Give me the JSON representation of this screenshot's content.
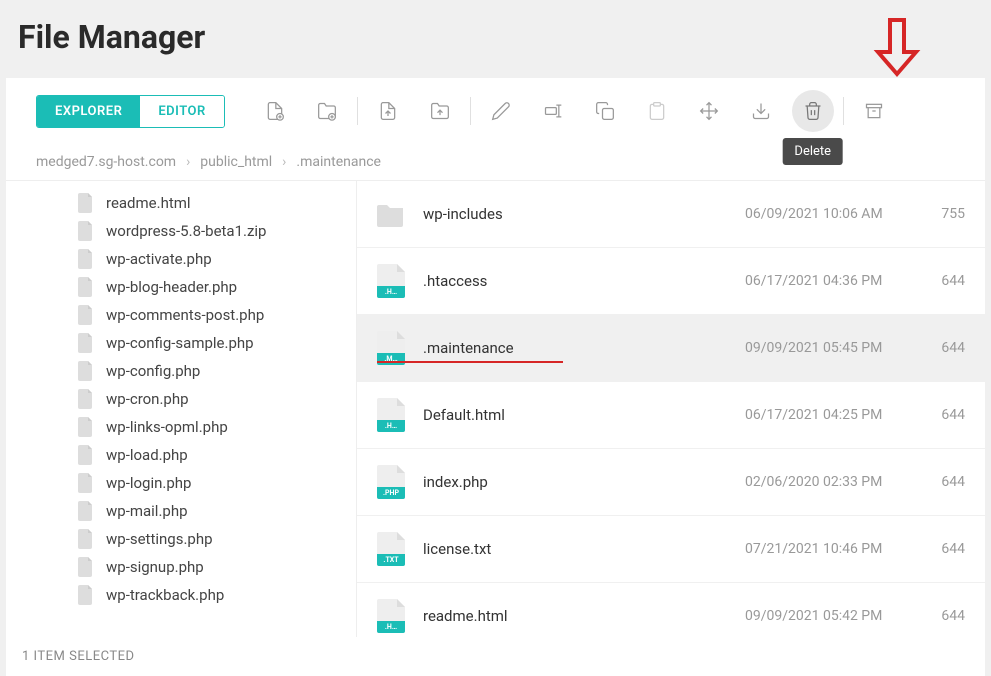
{
  "page_title": "File Manager",
  "tabs": {
    "explorer": "EXPLORER",
    "editor": "EDITOR"
  },
  "tooltip_delete": "Delete",
  "breadcrumb": [
    "medged7.sg-host.com",
    "public_html",
    ".maintenance"
  ],
  "sidebar_items": [
    "readme.html",
    "wordpress-5.8-beta1.zip",
    "wp-activate.php",
    "wp-blog-header.php",
    "wp-comments-post.php",
    "wp-config-sample.php",
    "wp-config.php",
    "wp-cron.php",
    "wp-links-opml.php",
    "wp-load.php",
    "wp-login.php",
    "wp-mail.php",
    "wp-settings.php",
    "wp-signup.php",
    "wp-trackback.php"
  ],
  "files": [
    {
      "name": "wp-includes",
      "date": "06/09/2021 10:06 AM",
      "perm": "755",
      "type": "folder",
      "tag": ""
    },
    {
      "name": ".htaccess",
      "date": "06/17/2021 04:36 PM",
      "perm": "644",
      "type": "file",
      "tag": ".H…"
    },
    {
      "name": ".maintenance",
      "date": "09/09/2021 05:45 PM",
      "perm": "644",
      "type": "file",
      "tag": ".M…",
      "selected": true
    },
    {
      "name": "Default.html",
      "date": "06/17/2021 04:25 PM",
      "perm": "644",
      "type": "file",
      "tag": ".H…"
    },
    {
      "name": "index.php",
      "date": "02/06/2020 02:33 PM",
      "perm": "644",
      "type": "file",
      "tag": ".PHP"
    },
    {
      "name": "license.txt",
      "date": "07/21/2021 10:46 PM",
      "perm": "644",
      "type": "file",
      "tag": ".TXT"
    },
    {
      "name": "readme.html",
      "date": "09/09/2021 05:42 PM",
      "perm": "644",
      "type": "file",
      "tag": ".H…"
    }
  ],
  "status_bar": "1 ITEM SELECTED"
}
